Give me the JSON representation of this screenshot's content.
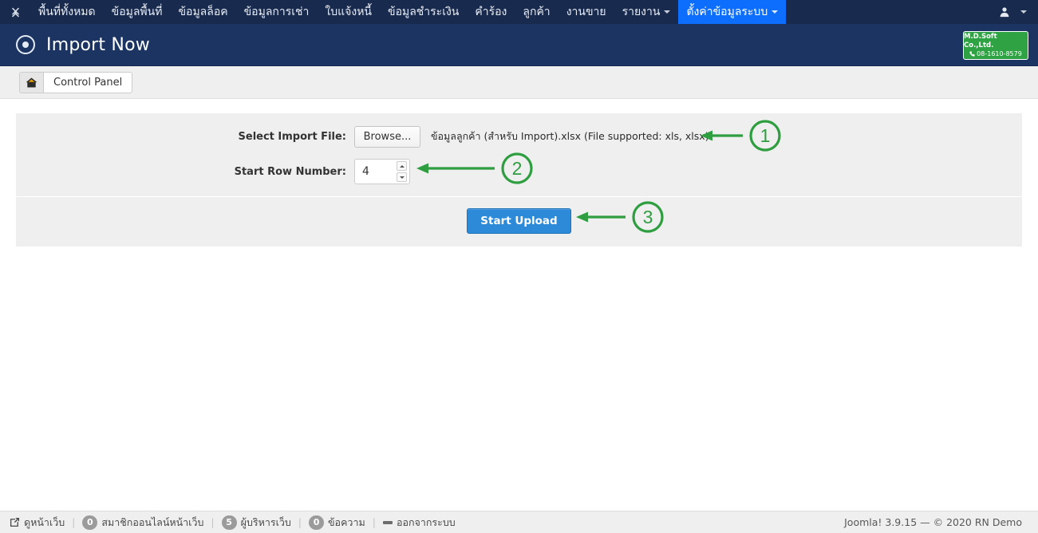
{
  "colors": {
    "navbar_bg": "#182a4e",
    "header_bg": "#1b3461",
    "active_nav": "#0d6efd",
    "panel_bg": "#efefef",
    "primary_button": "#2c8ad8",
    "badge_green": "#2fa344",
    "annotation_green": "#2e9e40"
  },
  "topnav": {
    "brand_icon": "joomla-logo-icon",
    "items": [
      {
        "label": "พื้นที่ทั้งหมด",
        "active": false,
        "has_caret": false
      },
      {
        "label": "ข้อมูลพื้นที่",
        "active": false,
        "has_caret": false
      },
      {
        "label": "ข้อมูลล็อค",
        "active": false,
        "has_caret": false
      },
      {
        "label": "ข้อมูลการเช่า",
        "active": false,
        "has_caret": false
      },
      {
        "label": "ใบแจ้งหนี้",
        "active": false,
        "has_caret": false
      },
      {
        "label": "ข้อมูลชำระเงิน",
        "active": false,
        "has_caret": false
      },
      {
        "label": "คำร้อง",
        "active": false,
        "has_caret": false
      },
      {
        "label": "ลูกค้า",
        "active": false,
        "has_caret": false
      },
      {
        "label": "งานขาย",
        "active": false,
        "has_caret": false
      },
      {
        "label": "รายงาน",
        "active": false,
        "has_caret": true
      },
      {
        "label": "ตั้งค่าข้อมูลระบบ",
        "active": true,
        "has_caret": true
      }
    ],
    "user_menu_icon": "user-avatar-icon"
  },
  "header": {
    "icon": "target-circle-icon",
    "title": "Import Now",
    "badge": {
      "company": "M.D.Soft Co.,Ltd.",
      "phone": "08-1610-8579",
      "phone_icon": "phone-icon"
    }
  },
  "breadcrumb": {
    "home_icon": "home-icon",
    "label": "Control Panel"
  },
  "form": {
    "file_row": {
      "label": "Select Import File:",
      "browse_label": "Browse...",
      "file_caption": "ข้อมูลลูกค้า (สำหรับ Import).xlsx (File supported: xls, xlsx)"
    },
    "row_number": {
      "label": "Start Row Number:",
      "value": "4",
      "placeholder": ""
    },
    "submit_label": "Start Upload"
  },
  "annotations": [
    {
      "number": "1",
      "target": "file-caption"
    },
    {
      "number": "2",
      "target": "start-row-input"
    },
    {
      "number": "3",
      "target": "start-upload-button"
    }
  ],
  "statusbar": {
    "preview_site": {
      "icon": "external-link-icon",
      "label": "ดูหน้าเว็บ"
    },
    "visitors": {
      "count": "0",
      "label": "สมาชิกออนไลน์หน้าเว็บ"
    },
    "admins": {
      "count": "5",
      "label": "ผู้บริหารเว็บ"
    },
    "messages": {
      "count": "0",
      "label": "ข้อความ"
    },
    "logout": {
      "icon": "logout-icon",
      "label": "ออกจากระบบ"
    },
    "copyright": "Joomla! 3.9.15  —  © 2020 RN Demo"
  }
}
